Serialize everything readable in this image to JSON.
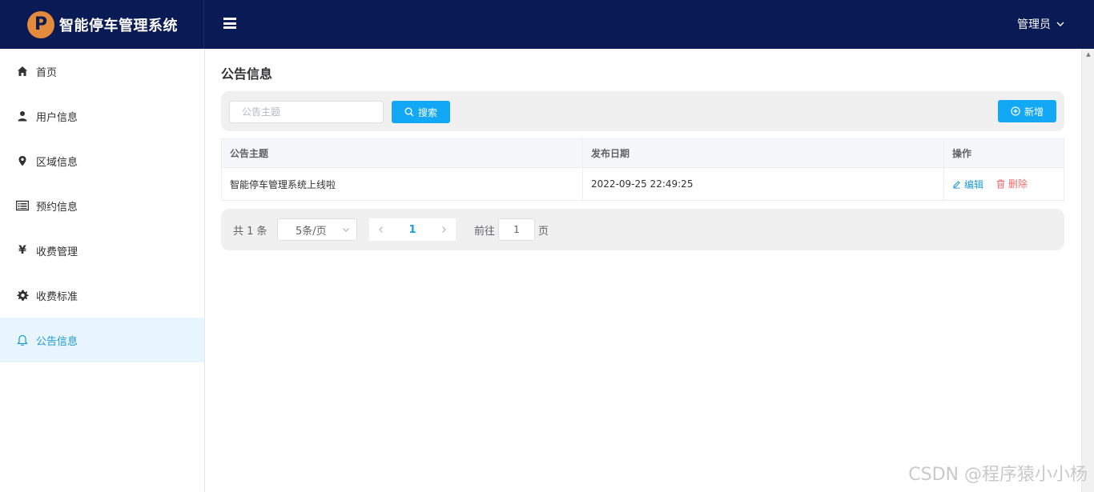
{
  "app": {
    "logo_letter": "P",
    "title": "智能停车管理系统"
  },
  "header": {
    "user_label": "管理员"
  },
  "sidebar": {
    "items": [
      {
        "label": "首页",
        "icon": "home-icon"
      },
      {
        "label": "用户信息",
        "icon": "user-icon"
      },
      {
        "label": "区域信息",
        "icon": "location-icon"
      },
      {
        "label": "预约信息",
        "icon": "list-icon"
      },
      {
        "label": "收费管理",
        "icon": "yen-icon"
      },
      {
        "label": "收费标准",
        "icon": "gear-icon"
      },
      {
        "label": "公告信息",
        "icon": "bell-icon",
        "active": true
      }
    ]
  },
  "main": {
    "title": "公告信息",
    "search": {
      "placeholder": "公告主题",
      "value": "",
      "button_label": "搜索"
    },
    "add_label": "新增",
    "table": {
      "columns": [
        "公告主题",
        "发布日期",
        "操作"
      ],
      "rows": [
        {
          "subject": "智能停车管理系统上线啦",
          "date": "2022-09-25 22:49:25",
          "edit_label": "编辑",
          "delete_label": "删除"
        }
      ]
    },
    "pagination": {
      "total_text": "共 1 条",
      "page_size": "5条/页",
      "current_page": "1",
      "goto_prefix": "前往",
      "goto_value": "1",
      "goto_suffix": "页"
    }
  },
  "watermark": "CSDN @程序猿小小杨",
  "colors": {
    "header_bg": "#0a1a55",
    "accent": "#13a8f5",
    "active_bg": "#e8f4fe",
    "danger": "#f56c6c",
    "logo": "#e38a3d"
  }
}
